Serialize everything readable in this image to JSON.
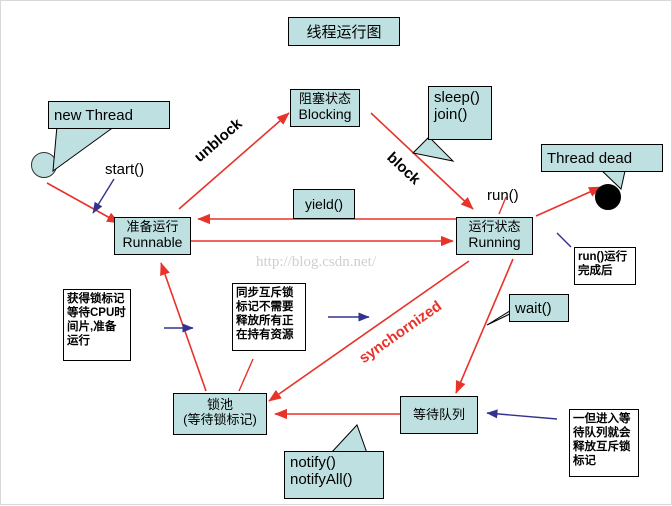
{
  "diagram": {
    "title": "线程运行图",
    "watermark": "http://blog.csdn.net/"
  },
  "nodes": [
    {
      "id": "runnable",
      "cn": "准备运行",
      "en": "Runnable"
    },
    {
      "id": "running",
      "cn": "运行状态",
      "en": "Running"
    },
    {
      "id": "blocking",
      "cn": "阻塞状态",
      "en": "Blocking"
    },
    {
      "id": "lockpool",
      "cn": "锁池",
      "en": "(等待锁标记)"
    },
    {
      "id": "waitqueue",
      "cn": "等待队列",
      "en": ""
    },
    {
      "id": "yield",
      "cn": "",
      "en": "yield()"
    }
  ],
  "callouts": [
    {
      "id": "new-thread",
      "line1": "new Thread",
      "line2": ""
    },
    {
      "id": "thread-dead",
      "line1": "Thread dead",
      "line2": ""
    },
    {
      "id": "sleep-join",
      "line1": "sleep()",
      "line2": "join()"
    },
    {
      "id": "wait",
      "line1": "wait()",
      "line2": ""
    },
    {
      "id": "notify",
      "line1": "notify()",
      "line2": "notifyAll()"
    }
  ],
  "notes": [
    {
      "id": "note-runnable",
      "lines": [
        "获得锁标记",
        "等待CPU时",
        "间片,准备",
        "运行"
      ]
    },
    {
      "id": "note-sync",
      "lines": [
        "同步互斥锁",
        "标记不需要",
        "释放所有正",
        "在持有资源"
      ]
    },
    {
      "id": "note-run-done",
      "lines": [
        "run()运行",
        "完成后"
      ]
    },
    {
      "id": "note-waitqueue",
      "lines": [
        "一但进入等",
        "待队列就会",
        "释放互斥锁",
        "标记"
      ]
    }
  ],
  "edge_labels": [
    {
      "id": "start",
      "text": "start()"
    },
    {
      "id": "unblock",
      "text": "unblock"
    },
    {
      "id": "block",
      "text": "block"
    },
    {
      "id": "run",
      "text": "run()"
    },
    {
      "id": "synchornized",
      "text": "synchornized"
    }
  ],
  "colors": {
    "node_fill": "#bfe0e0",
    "arrow_red": "#e8322a",
    "arrow_blue": "#33338f",
    "border": "#000000",
    "watermark": "#cfcfcf"
  }
}
